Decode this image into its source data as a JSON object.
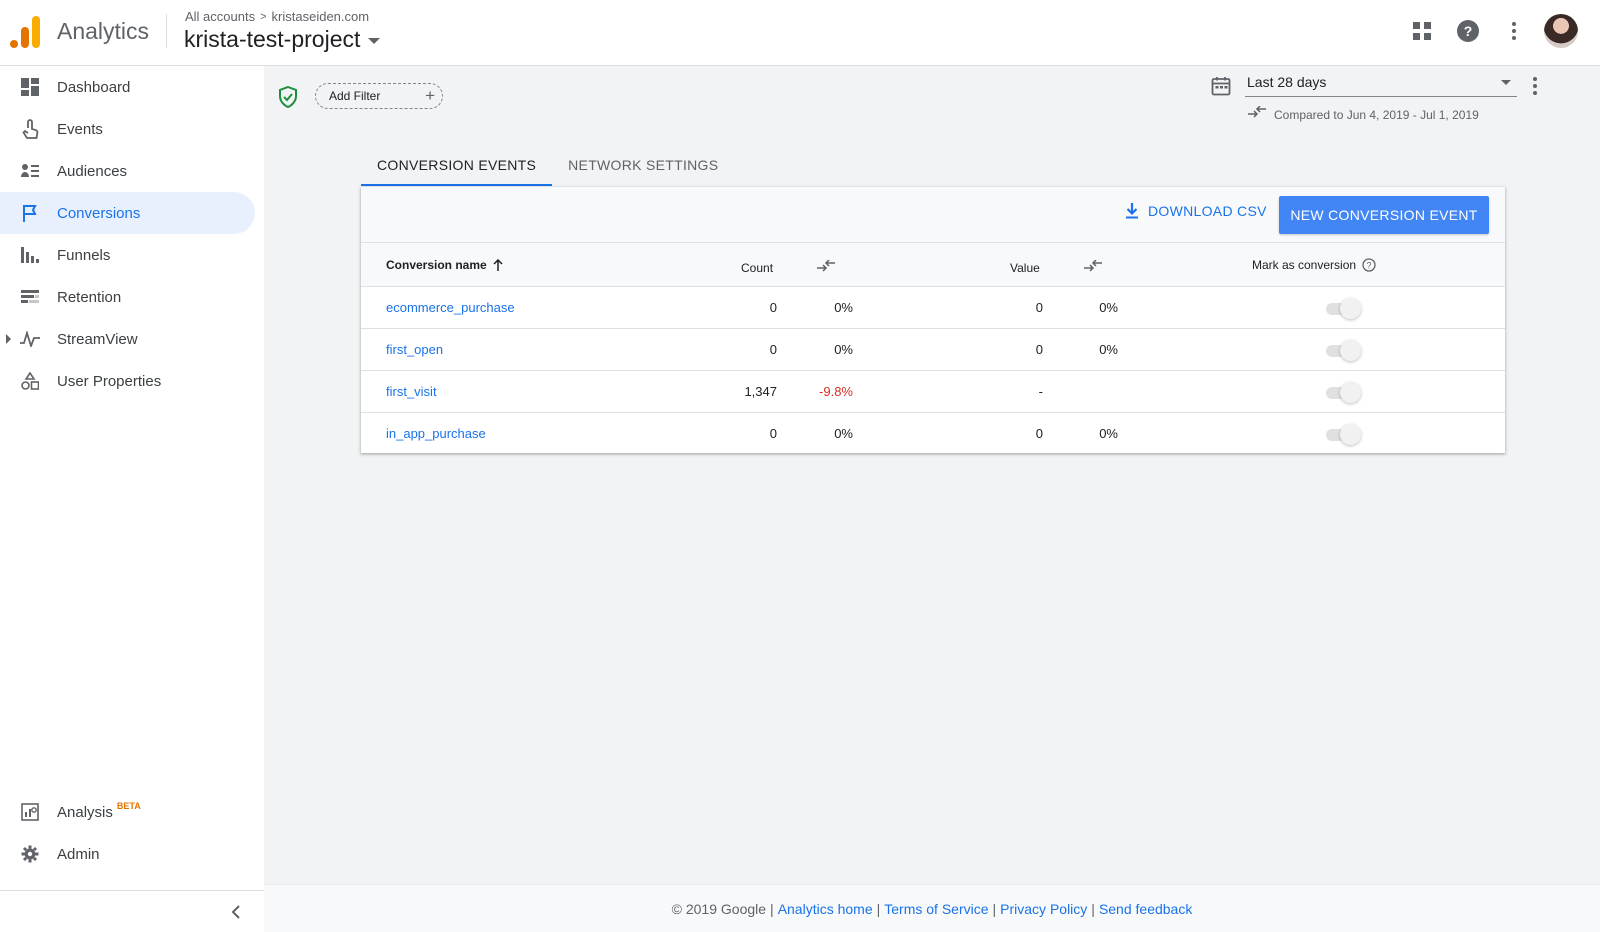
{
  "header": {
    "app_name": "Analytics",
    "breadcrumb": [
      "All accounts",
      "kristaseiden.com"
    ],
    "breadcrumb_separator": ">",
    "project": "krista-test-project",
    "icons": [
      "apps-icon",
      "help-icon",
      "more-vert-icon",
      "avatar"
    ]
  },
  "sidebar": {
    "items": [
      {
        "label": "Dashboard",
        "icon": "dashboard-icon"
      },
      {
        "label": "Events",
        "icon": "touch-icon"
      },
      {
        "label": "Audiences",
        "icon": "audiences-icon"
      },
      {
        "label": "Conversions",
        "icon": "flag-icon",
        "active": true
      },
      {
        "label": "Funnels",
        "icon": "funnel-icon"
      },
      {
        "label": "Retention",
        "icon": "retention-icon"
      },
      {
        "label": "StreamView",
        "icon": "streamview-icon"
      },
      {
        "label": "User Properties",
        "icon": "shapes-icon"
      }
    ],
    "bottom_items": [
      {
        "label": "Analysis",
        "badge": "BETA",
        "icon": "analysis-icon"
      },
      {
        "label": "Admin",
        "icon": "gear-icon"
      }
    ]
  },
  "toolbar": {
    "add_filter_label": "Add Filter",
    "date_range": "Last 28 days",
    "compared_text": "Compared to Jun 4, 2019 - Jul 1, 2019"
  },
  "tabs": [
    {
      "label": "CONVERSION EVENTS",
      "active": true
    },
    {
      "label": "NETWORK SETTINGS",
      "active": false
    }
  ],
  "card": {
    "download_label": "DOWNLOAD CSV",
    "new_event_label": "NEW CONVERSION EVENT",
    "columns": {
      "name": "Conversion name",
      "count": "Count",
      "value": "Value",
      "mark": "Mark as conversion"
    },
    "rows": [
      {
        "name": "ecommerce_purchase",
        "count": "0",
        "count_change": "0%",
        "value": "0",
        "value_change": "0%"
      },
      {
        "name": "first_open",
        "count": "0",
        "count_change": "0%",
        "value": "0",
        "value_change": "0%"
      },
      {
        "name": "first_visit",
        "count": "1,347",
        "count_change": "-9.8%",
        "value": "-",
        "value_change": ""
      },
      {
        "name": "in_app_purchase",
        "count": "0",
        "count_change": "0%",
        "value": "0",
        "value_change": "0%"
      }
    ]
  },
  "footer": {
    "copyright": "© 2019 Google",
    "separator": "|",
    "links": [
      "Analytics home",
      "Terms of Service",
      "Privacy Policy",
      "Send feedback"
    ]
  },
  "colors": {
    "accent": "#1a73e8",
    "primary_button": "#4285f4",
    "negative": "#d93025",
    "active_nav_bg": "#e8f0fe",
    "main_bg": "#f1f3f4",
    "shield_green": "#1e8e3e"
  }
}
